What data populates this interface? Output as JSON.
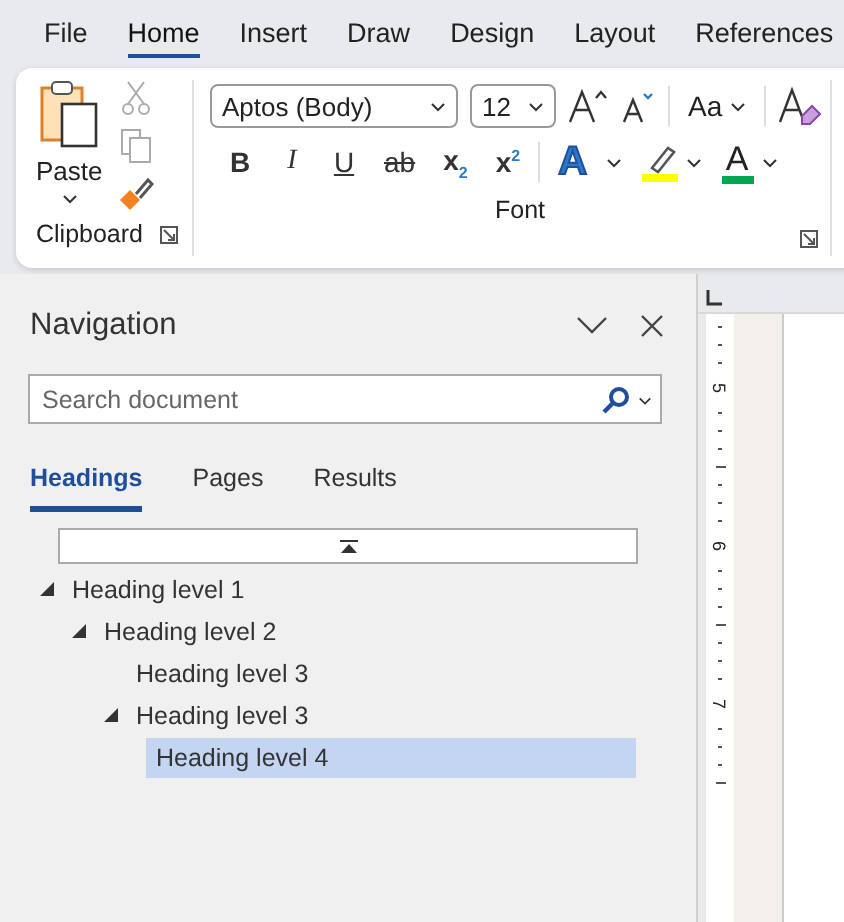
{
  "menu_tabs": [
    {
      "label": "File",
      "selected": false
    },
    {
      "label": "Home",
      "selected": true
    },
    {
      "label": "Insert",
      "selected": false
    },
    {
      "label": "Draw",
      "selected": false
    },
    {
      "label": "Design",
      "selected": false
    },
    {
      "label": "Layout",
      "selected": false
    },
    {
      "label": "References",
      "selected": false
    }
  ],
  "ribbon": {
    "clipboard": {
      "paste_label": "Paste",
      "group_label": "Clipboard"
    },
    "font": {
      "font_name": "Aptos (Body)",
      "font_size": "12",
      "change_case": "Aa",
      "format_buttons": [
        {
          "kind": "bold",
          "label": "B"
        },
        {
          "kind": "italic",
          "label": "I"
        },
        {
          "kind": "underline",
          "label": "U"
        },
        {
          "kind": "strike",
          "label": "ab"
        },
        {
          "kind": "subscript",
          "label": "x$_{2}$"
        },
        {
          "kind": "superscript",
          "label": "x$^{2}$"
        }
      ],
      "text_effects": "A",
      "font_color": {
        "label": "A",
        "color": "#00a651"
      },
      "group_label": "Font"
    }
  },
  "navigation": {
    "title": "Navigation",
    "search": {
      "placeholder": "Search document"
    },
    "tabs": [
      {
        "label": "Headings",
        "selected": true
      },
      {
        "label": "Pages",
        "selected": false
      },
      {
        "label": "Results",
        "selected": false
      }
    ],
    "tree": [
      {
        "label": "Heading level 1",
        "expanded": true,
        "selected": false,
        "children": [
          {
            "label": "Heading level 2",
            "expanded": true,
            "selected": false,
            "children": [
              {
                "label": "Heading level 3",
                "selected": false
              },
              {
                "label": "Heading level 3",
                "expanded": true,
                "selected": false,
                "children": [
                  {
                    "label": "Heading level 4",
                    "selected": true
                  }
                ]
              }
            ]
          }
        ]
      }
    ]
  },
  "ruler": {
    "labels": [
      "5",
      "6",
      "7"
    ]
  }
}
